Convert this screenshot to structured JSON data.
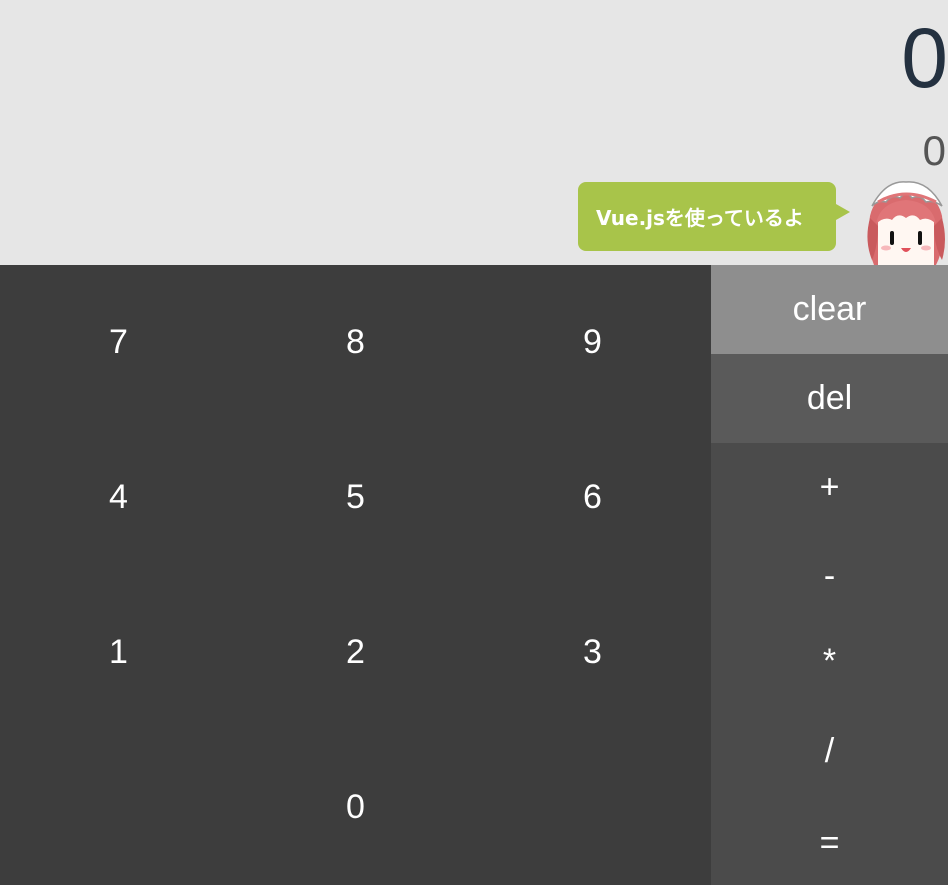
{
  "display": {
    "main_value": "0",
    "sub_value": "0"
  },
  "mascot": {
    "speech": "Vue.jsを使っているよ",
    "icon": "maid-girl-avatar",
    "bubble_color": "#a8c44a"
  },
  "keypad": {
    "digits": [
      "7",
      "8",
      "9",
      "4",
      "5",
      "6",
      "1",
      "2",
      "3",
      "0"
    ]
  },
  "operators": {
    "clear": "clear",
    "del": "del",
    "plus": "+",
    "minus": "-",
    "multiply": "*",
    "divide": "/",
    "equals": "="
  },
  "colors": {
    "display_bg": "#e6e6e6",
    "keypad_bg": "#3d3d3d",
    "ops_bg": "#4b4b4b",
    "clear_bg": "#8e8e8e",
    "del_bg": "#5a5a5a"
  }
}
